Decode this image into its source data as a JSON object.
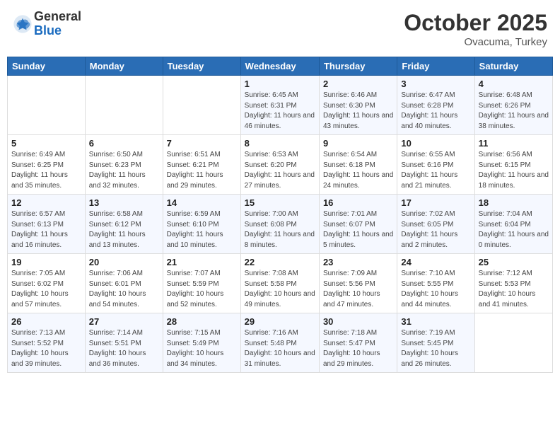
{
  "header": {
    "logo_general": "General",
    "logo_blue": "Blue",
    "month": "October 2025",
    "location": "Ovacuma, Turkey"
  },
  "weekdays": [
    "Sunday",
    "Monday",
    "Tuesday",
    "Wednesday",
    "Thursday",
    "Friday",
    "Saturday"
  ],
  "weeks": [
    [
      null,
      null,
      null,
      {
        "day": "1",
        "sunrise": "6:45 AM",
        "sunset": "6:31 PM",
        "daylight": "11 hours and 46 minutes."
      },
      {
        "day": "2",
        "sunrise": "6:46 AM",
        "sunset": "6:30 PM",
        "daylight": "11 hours and 43 minutes."
      },
      {
        "day": "3",
        "sunrise": "6:47 AM",
        "sunset": "6:28 PM",
        "daylight": "11 hours and 40 minutes."
      },
      {
        "day": "4",
        "sunrise": "6:48 AM",
        "sunset": "6:26 PM",
        "daylight": "11 hours and 38 minutes."
      }
    ],
    [
      {
        "day": "5",
        "sunrise": "6:49 AM",
        "sunset": "6:25 PM",
        "daylight": "11 hours and 35 minutes."
      },
      {
        "day": "6",
        "sunrise": "6:50 AM",
        "sunset": "6:23 PM",
        "daylight": "11 hours and 32 minutes."
      },
      {
        "day": "7",
        "sunrise": "6:51 AM",
        "sunset": "6:21 PM",
        "daylight": "11 hours and 29 minutes."
      },
      {
        "day": "8",
        "sunrise": "6:53 AM",
        "sunset": "6:20 PM",
        "daylight": "11 hours and 27 minutes."
      },
      {
        "day": "9",
        "sunrise": "6:54 AM",
        "sunset": "6:18 PM",
        "daylight": "11 hours and 24 minutes."
      },
      {
        "day": "10",
        "sunrise": "6:55 AM",
        "sunset": "6:16 PM",
        "daylight": "11 hours and 21 minutes."
      },
      {
        "day": "11",
        "sunrise": "6:56 AM",
        "sunset": "6:15 PM",
        "daylight": "11 hours and 18 minutes."
      }
    ],
    [
      {
        "day": "12",
        "sunrise": "6:57 AM",
        "sunset": "6:13 PM",
        "daylight": "11 hours and 16 minutes."
      },
      {
        "day": "13",
        "sunrise": "6:58 AM",
        "sunset": "6:12 PM",
        "daylight": "11 hours and 13 minutes."
      },
      {
        "day": "14",
        "sunrise": "6:59 AM",
        "sunset": "6:10 PM",
        "daylight": "11 hours and 10 minutes."
      },
      {
        "day": "15",
        "sunrise": "7:00 AM",
        "sunset": "6:08 PM",
        "daylight": "11 hours and 8 minutes."
      },
      {
        "day": "16",
        "sunrise": "7:01 AM",
        "sunset": "6:07 PM",
        "daylight": "11 hours and 5 minutes."
      },
      {
        "day": "17",
        "sunrise": "7:02 AM",
        "sunset": "6:05 PM",
        "daylight": "11 hours and 2 minutes."
      },
      {
        "day": "18",
        "sunrise": "7:04 AM",
        "sunset": "6:04 PM",
        "daylight": "11 hours and 0 minutes."
      }
    ],
    [
      {
        "day": "19",
        "sunrise": "7:05 AM",
        "sunset": "6:02 PM",
        "daylight": "10 hours and 57 minutes."
      },
      {
        "day": "20",
        "sunrise": "7:06 AM",
        "sunset": "6:01 PM",
        "daylight": "10 hours and 54 minutes."
      },
      {
        "day": "21",
        "sunrise": "7:07 AM",
        "sunset": "5:59 PM",
        "daylight": "10 hours and 52 minutes."
      },
      {
        "day": "22",
        "sunrise": "7:08 AM",
        "sunset": "5:58 PM",
        "daylight": "10 hours and 49 minutes."
      },
      {
        "day": "23",
        "sunrise": "7:09 AM",
        "sunset": "5:56 PM",
        "daylight": "10 hours and 47 minutes."
      },
      {
        "day": "24",
        "sunrise": "7:10 AM",
        "sunset": "5:55 PM",
        "daylight": "10 hours and 44 minutes."
      },
      {
        "day": "25",
        "sunrise": "7:12 AM",
        "sunset": "5:53 PM",
        "daylight": "10 hours and 41 minutes."
      }
    ],
    [
      {
        "day": "26",
        "sunrise": "7:13 AM",
        "sunset": "5:52 PM",
        "daylight": "10 hours and 39 minutes."
      },
      {
        "day": "27",
        "sunrise": "7:14 AM",
        "sunset": "5:51 PM",
        "daylight": "10 hours and 36 minutes."
      },
      {
        "day": "28",
        "sunrise": "7:15 AM",
        "sunset": "5:49 PM",
        "daylight": "10 hours and 34 minutes."
      },
      {
        "day": "29",
        "sunrise": "7:16 AM",
        "sunset": "5:48 PM",
        "daylight": "10 hours and 31 minutes."
      },
      {
        "day": "30",
        "sunrise": "7:18 AM",
        "sunset": "5:47 PM",
        "daylight": "10 hours and 29 minutes."
      },
      {
        "day": "31",
        "sunrise": "7:19 AM",
        "sunset": "5:45 PM",
        "daylight": "10 hours and 26 minutes."
      },
      null
    ]
  ]
}
